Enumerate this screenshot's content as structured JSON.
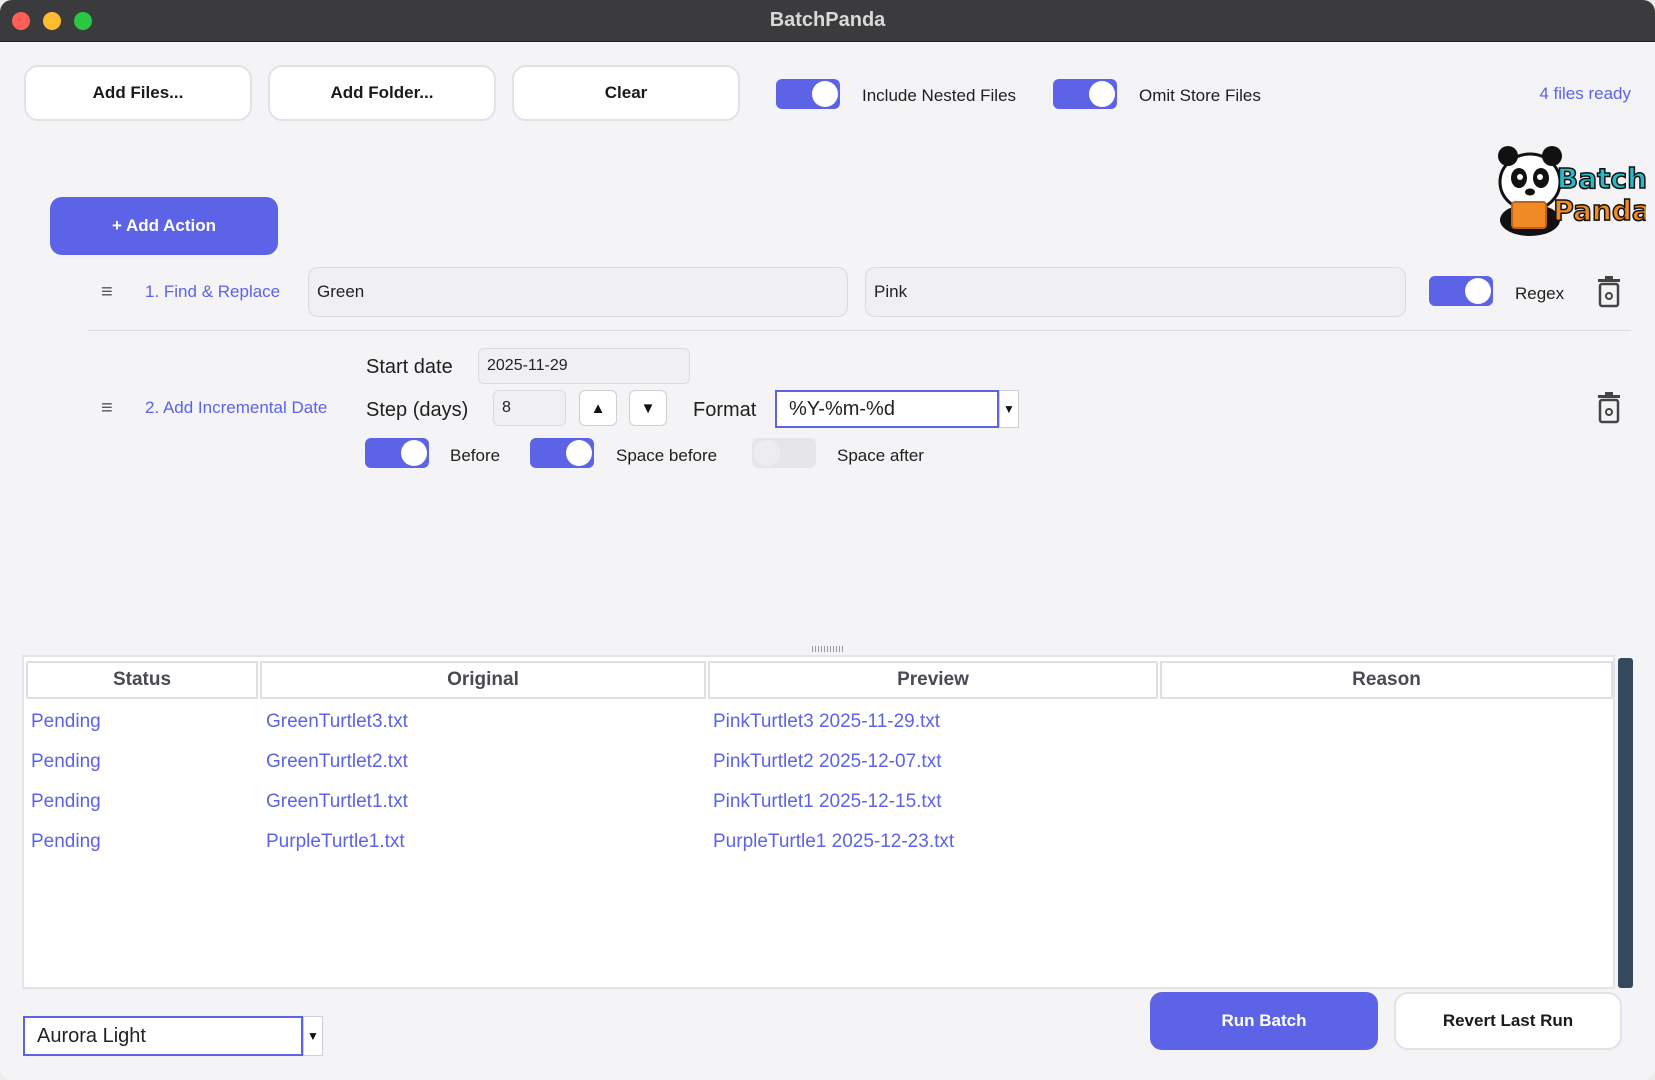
{
  "window": {
    "title": "BatchPanda"
  },
  "toolbar": {
    "add_files": "Add Files...",
    "add_folder": "Add Folder...",
    "clear": "Clear",
    "include_nested_label": "Include Nested Files",
    "include_nested_on": true,
    "omit_store_label": "Omit Store Files",
    "omit_store_on": true,
    "files_ready": "4 files ready"
  },
  "actions": {
    "add_action_label": "+ Add Action",
    "find_replace": {
      "title": "1. Find & Replace",
      "find_value": "Green",
      "replace_value": "Pink",
      "regex_label": "Regex",
      "regex_on": true
    },
    "incremental_date": {
      "title": "2. Add Incremental Date",
      "start_date_label": "Start date",
      "start_date_value": "2025-11-29",
      "step_label": "Step (days)",
      "step_value": "8",
      "format_label": "Format",
      "format_value": "%Y-%m-%d",
      "before_label": "Before",
      "before_on": true,
      "space_before_label": "Space before",
      "space_before_on": true,
      "space_after_label": "Space after",
      "space_after_on": false
    }
  },
  "table": {
    "columns": [
      "Status",
      "Original",
      "Preview",
      "Reason"
    ],
    "rows": [
      {
        "status": "Pending",
        "original": "GreenTurtlet3.txt",
        "preview": "PinkTurtlet3 2025-11-29.txt",
        "reason": ""
      },
      {
        "status": "Pending",
        "original": "GreenTurtlet2.txt",
        "preview": "PinkTurtlet2 2025-12-07.txt",
        "reason": ""
      },
      {
        "status": "Pending",
        "original": "GreenTurtlet1.txt",
        "preview": "PinkTurtlet1 2025-12-15.txt",
        "reason": ""
      },
      {
        "status": "Pending",
        "original": "PurpleTurtle1.txt",
        "preview": "PurpleTurtle1 2025-12-23.txt",
        "reason": ""
      }
    ]
  },
  "footer": {
    "theme_value": "Aurora Light",
    "run_batch": "Run Batch",
    "revert_last_run": "Revert Last Run"
  },
  "logo": {
    "line1": "Batch",
    "line2": "Panda"
  },
  "colors": {
    "accent": "#5c63e6",
    "titlebar": "#3b3b3d",
    "scrollbar": "#34495e"
  },
  "icons": [
    "drag-handle-icon",
    "trash-icon",
    "chevron-up-icon",
    "chevron-down-icon",
    "dropdown-arrow-icon",
    "panda-logo"
  ]
}
